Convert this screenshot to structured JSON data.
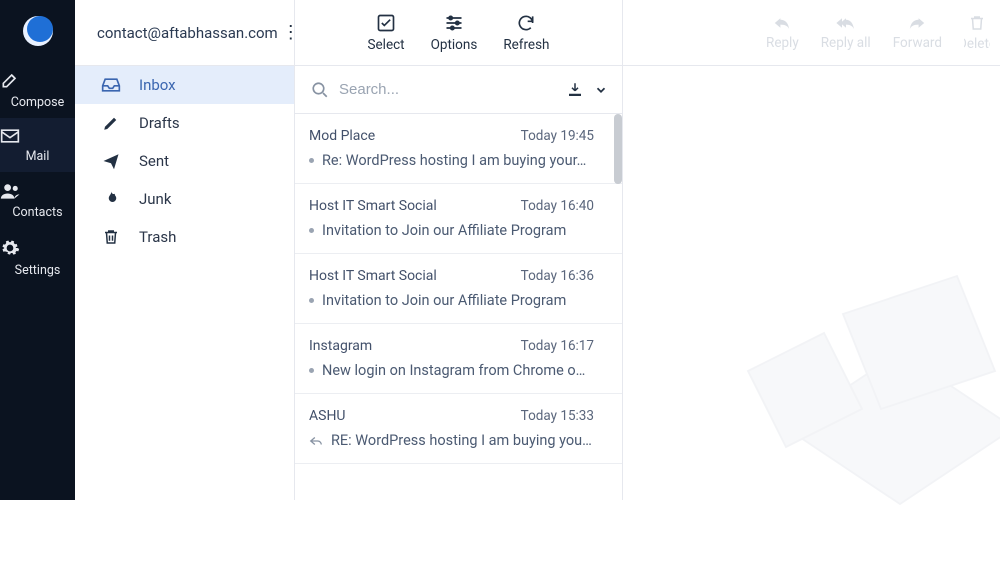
{
  "account_email": "contact@aftabhassan.com",
  "nav": {
    "compose": "Compose",
    "mail": "Mail",
    "contacts": "Contacts",
    "settings": "Settings"
  },
  "folders": [
    {
      "label": "Inbox"
    },
    {
      "label": "Drafts"
    },
    {
      "label": "Sent"
    },
    {
      "label": "Junk"
    },
    {
      "label": "Trash"
    }
  ],
  "toolbar": {
    "select": "Select",
    "options": "Options",
    "refresh": "Refresh"
  },
  "search": {
    "placeholder": "Search..."
  },
  "messages": [
    {
      "from": "Mod Place",
      "date": "Today 19:45",
      "subject": "Re: WordPress hosting I am buying your…",
      "replied": false
    },
    {
      "from": "Host IT Smart Social",
      "date": "Today 16:40",
      "subject": "Invitation to Join our Affiliate Program",
      "replied": false
    },
    {
      "from": "Host IT Smart Social",
      "date": "Today 16:36",
      "subject": "Invitation to Join our Affiliate Program",
      "replied": false
    },
    {
      "from": "Instagram",
      "date": "Today 16:17",
      "subject": "New login on Instagram from Chrome o…",
      "replied": false
    },
    {
      "from": "ASHU",
      "date": "Today 15:33",
      "subject": "RE: WordPress hosting I am buying your…",
      "replied": true
    }
  ],
  "preview_actions": {
    "reply": "Reply",
    "reply_all": "Reply all",
    "forward": "Forward",
    "delete": "Delete"
  }
}
